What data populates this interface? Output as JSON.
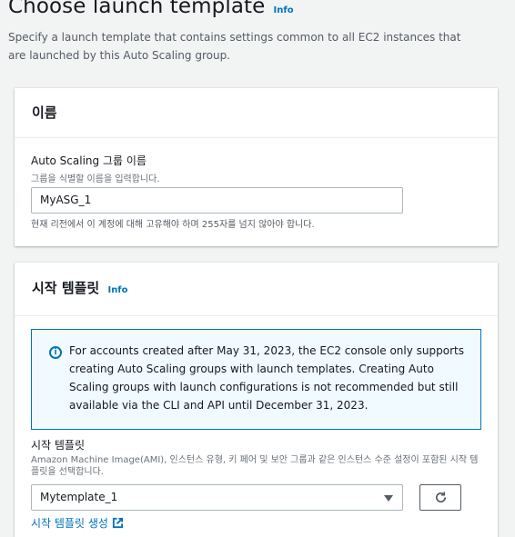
{
  "page": {
    "title": "Choose launch template",
    "info_label": "Info",
    "description": "Specify a launch template that contains settings common to all EC2 instances that are launched by this Auto Scaling group."
  },
  "name_section": {
    "header": "이름",
    "field_label": "Auto Scaling 그룹 이름",
    "field_description": "그룹을 식별할 이름을 입력합니다.",
    "input_value": "MyASG_1",
    "constraint": "현재 리전에서 이 계정에 대해 고유해야 하며 255자를 넘지 않아야 합니다."
  },
  "template_section": {
    "header": "시작 템플릿",
    "info_label": "Info",
    "alert_text": "For accounts created after May 31, 2023, the EC2 console only supports creating Auto Scaling groups with launch templates. Creating Auto Scaling groups with launch configurations is not recommended but still available via the CLI and API until December 31, 2023.",
    "field_label": "시작 템플릿",
    "field_description": "Amazon Machine Image(AMI), 인스턴스 유형, 키 페어 및 보안 그룹과 같은 인스턴스 수준 설정이 포함된 시작 템플릿을 선택합니다.",
    "selected_template": "Mytemplate_1",
    "create_link": "시작 템플릿 생성"
  },
  "icons": {
    "alert": "info-circle-icon",
    "select": "caret-down-icon",
    "refresh": "refresh-icon",
    "external": "external-link-icon"
  },
  "colors": {
    "link": "#0073bb",
    "alert_bg": "#f1faff",
    "alert_border": "#0073bb",
    "text": "#16191f",
    "muted": "#545b64"
  }
}
